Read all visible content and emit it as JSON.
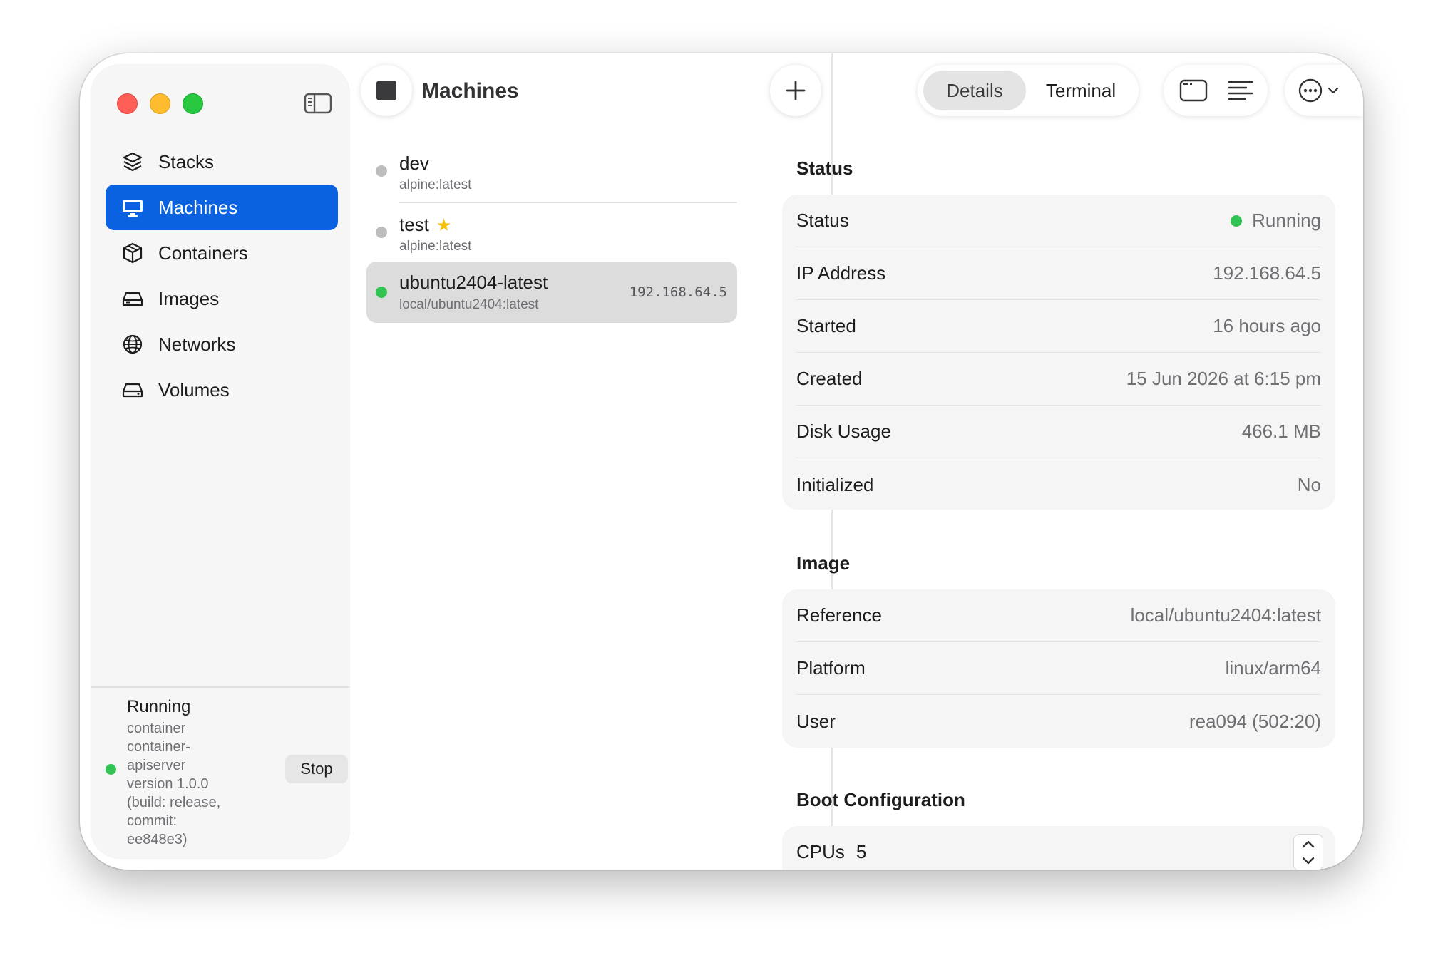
{
  "sidebar": {
    "items": [
      {
        "label": "Stacks",
        "icon": "stack-layers-icon"
      },
      {
        "label": "Machines",
        "icon": "monitor-icon",
        "active": true
      },
      {
        "label": "Containers",
        "icon": "box-icon"
      },
      {
        "label": "Images",
        "icon": "drive-icon"
      },
      {
        "label": "Networks",
        "icon": "globe-icon"
      },
      {
        "label": "Volumes",
        "icon": "disk-icon"
      }
    ],
    "daemon": {
      "title": "Running",
      "lines": [
        "container",
        "container-",
        "apiserver",
        "version 1.0.0",
        "(build: release,",
        "commit:",
        "ee848e3)"
      ],
      "stop_label": "Stop"
    }
  },
  "list": {
    "title": "Machines",
    "machines": [
      {
        "name": "dev",
        "image": "alpine:latest",
        "status": "stopped"
      },
      {
        "name": "test",
        "image": "alpine:latest",
        "status": "stopped",
        "starred": true
      },
      {
        "name": "ubuntu2404-latest",
        "image": "local/ubuntu2404:latest",
        "status": "running",
        "ip": "192.168.64.5",
        "selected": true
      }
    ]
  },
  "detail": {
    "tabs": {
      "details": "Details",
      "terminal": "Terminal"
    },
    "status_section": {
      "title": "Status",
      "rows": [
        {
          "key": "Status",
          "value": "Running"
        },
        {
          "key": "IP Address",
          "value": "192.168.64.5"
        },
        {
          "key": "Started",
          "value": "16 hours ago"
        },
        {
          "key": "Created",
          "value": "15 Jun 2026 at 6:15 pm"
        },
        {
          "key": "Disk Usage",
          "value": "466.1 MB"
        },
        {
          "key": "Initialized",
          "value": "No"
        }
      ]
    },
    "image_section": {
      "title": "Image",
      "rows": [
        {
          "key": "Reference",
          "value": "local/ubuntu2404:latest"
        },
        {
          "key": "Platform",
          "value": "linux/arm64"
        },
        {
          "key": "User",
          "value": "rea094 (502:20)"
        }
      ]
    },
    "boot_section": {
      "title": "Boot Configuration",
      "cpus_label": "CPUs",
      "cpus_value": "5"
    }
  },
  "colors": {
    "accent": "#0a62e0",
    "running": "#31c452",
    "stopped": "#bdbdbd",
    "star": "#f6c20b"
  }
}
